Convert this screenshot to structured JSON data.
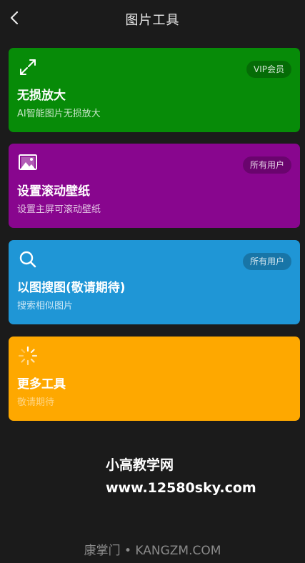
{
  "header": {
    "title": "图片工具",
    "back_icon": "chevron-left-icon"
  },
  "cards": [
    {
      "title": "无损放大",
      "subtitle": "AI智能图片无损放大",
      "badge": "VIP会员",
      "color": "#078b08",
      "icon": "expand-arrows-icon"
    },
    {
      "title": "设置滚动壁纸",
      "subtitle": "设置主屏可滚动壁纸",
      "badge": "所有用户",
      "color": "#88068e",
      "icon": "image-icon"
    },
    {
      "title": "以图搜图(敬请期待)",
      "subtitle": "搜索相似图片",
      "badge": "所有用户",
      "color": "#1f96d6",
      "icon": "search-icon"
    },
    {
      "title": "更多工具",
      "subtitle": "敬请期待",
      "badge": "",
      "color": "#fea800",
      "icon": "loading-spinner-icon"
    }
  ],
  "watermark": {
    "line1": "小高教学网",
    "line2": "www.12580sky.com"
  },
  "footer": {
    "text": "康掌门 • KANGZM.COM"
  }
}
